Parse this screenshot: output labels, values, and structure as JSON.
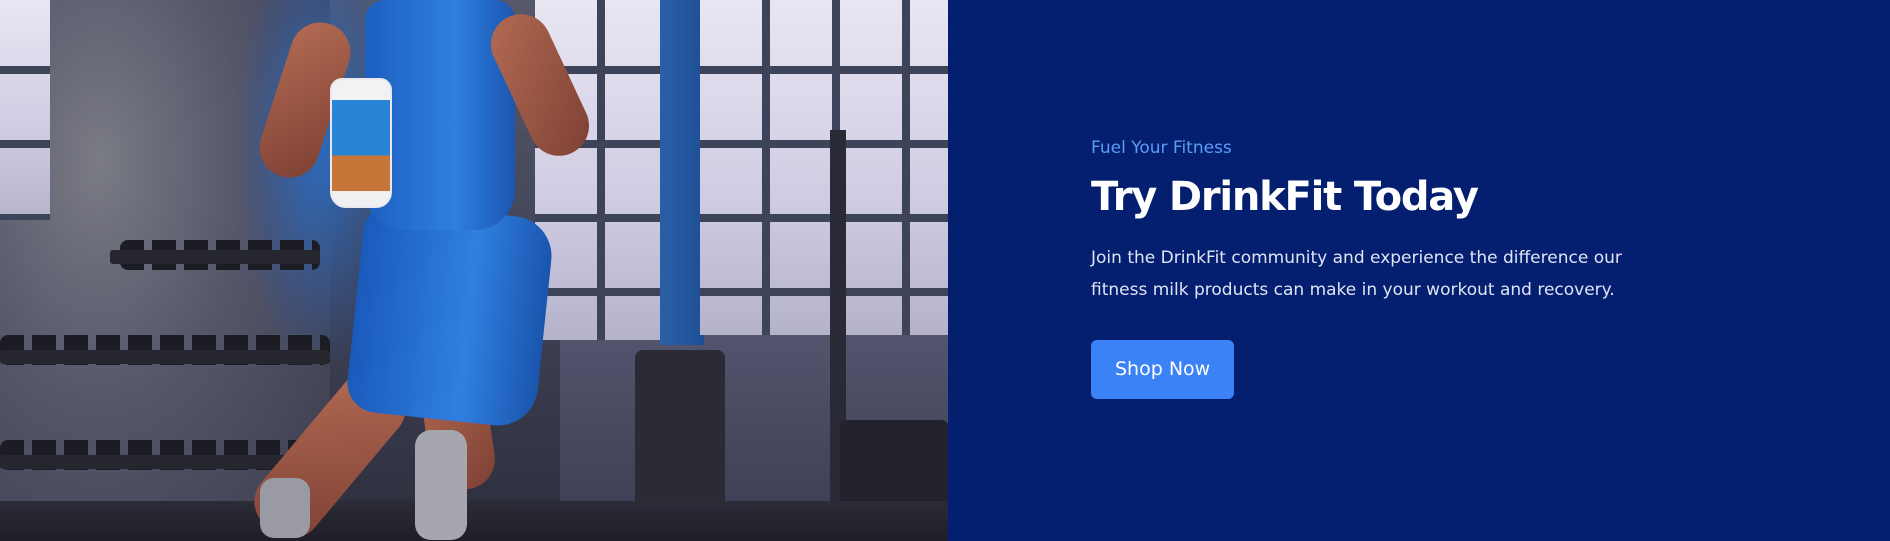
{
  "hero": {
    "image": {
      "description_icon": "athlete-photo",
      "alt": ""
    },
    "eyebrow": "Fuel Your Fitness",
    "headline": "Try DrinkFit Today",
    "description": "Join the DrinkFit community and experience the difference our fitness milk products can make in your workout and recovery.",
    "cta_label": "Shop Now"
  },
  "colors": {
    "panel_background": "#051f70",
    "accent": "#3a82f6",
    "eyebrow": "#5b9cf5",
    "headline": "#ffffff",
    "body_text": "#dfe4f5"
  }
}
